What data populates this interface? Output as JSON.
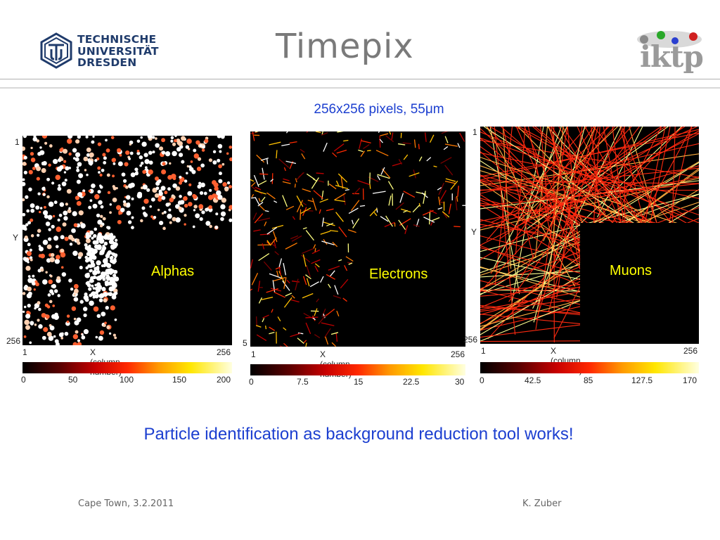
{
  "header": {
    "institution_lines": [
      "TECHNISCHE",
      "UNIVERSITÄT",
      "DRESDEN"
    ],
    "title": "Timepix",
    "right_logo_text": "iktp"
  },
  "subtitle": "256x256 pixels, 55μm",
  "panels": [
    {
      "label": "Alphas",
      "y_label": "Y",
      "x_label": "X (column number)",
      "x_min": "1",
      "x_max": "256",
      "y_min": "1",
      "y_max": "256",
      "colorbar_ticks": [
        "0",
        "50",
        "100",
        "150",
        "200"
      ]
    },
    {
      "label": "Electrons",
      "y_label": "",
      "x_label": "X (column number)",
      "x_min": "1",
      "x_max": "256",
      "y_min": "",
      "y_max": "5",
      "colorbar_ticks": [
        "0",
        "7.5",
        "15",
        "22.5",
        "30"
      ]
    },
    {
      "label": "Muons",
      "y_label": "Y",
      "x_label": "X (column number)",
      "x_min": "1",
      "x_max": "256",
      "y_min": "1",
      "y_max": "256",
      "colorbar_ticks": [
        "0",
        "42.5",
        "85",
        "127.5",
        "170"
      ]
    }
  ],
  "conclusion": "Particle identification as background reduction tool works!",
  "footer": {
    "left": "Cape Town, 3.2.2011",
    "right": "K. Zuber"
  },
  "colors": {
    "accent_blue": "#1c3fd0",
    "label_yellow": "#ffff00",
    "tud_blue": "#1f3b6b"
  }
}
